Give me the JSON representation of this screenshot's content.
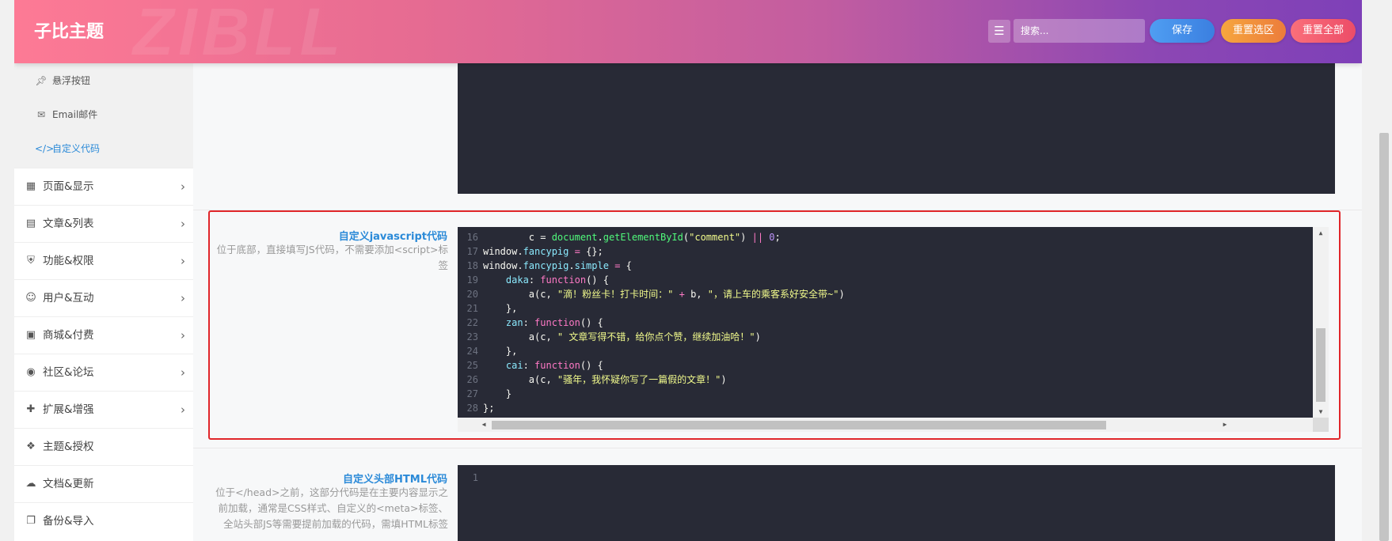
{
  "header": {
    "title": "子比主题",
    "watermark": "ZIBLL",
    "search_placeholder": "搜索...",
    "save_label": "保存",
    "reset_section_label": "重置选区",
    "reset_all_label": "重置全部"
  },
  "sidebar": {
    "sub_items": [
      {
        "icon": "pin-icon",
        "label": "悬浮按钮"
      },
      {
        "icon": "envelope-icon",
        "label": "Email邮件"
      },
      {
        "icon": "code-icon",
        "label": "自定义代码",
        "active": true
      }
    ],
    "items": [
      {
        "icon": "calendar-icon",
        "label": "页面&显示"
      },
      {
        "icon": "map-icon",
        "label": "文章&列表"
      },
      {
        "icon": "shield-icon",
        "label": "功能&权限"
      },
      {
        "icon": "user-icon",
        "label": "用户&互动"
      },
      {
        "icon": "cart-icon",
        "label": "商城&付费"
      },
      {
        "icon": "dribbble-icon",
        "label": "社区&论坛"
      },
      {
        "icon": "puzzle-icon",
        "label": "扩展&增强"
      },
      {
        "icon": "theme-icon",
        "label": "主题&授权"
      },
      {
        "icon": "cloud-download-icon",
        "label": "文档&更新"
      },
      {
        "icon": "copy-icon",
        "label": "备份&导入"
      }
    ]
  },
  "fields": {
    "js": {
      "title": "自定义javascript代码",
      "desc": "位于底部，直接填写JS代码，不需要添加<script>标签",
      "lines": [
        {
          "n": "16",
          "tokens": [
            [
              "",
              "        c = "
            ],
            [
              "fn",
              "document"
            ],
            [
              "",
              "."
            ],
            [
              "fn",
              "getElementById"
            ],
            [
              "",
              "("
            ],
            [
              "str",
              "\"comment\""
            ],
            [
              "",
              ") "
            ],
            [
              "kw",
              "||"
            ],
            [
              "",
              " "
            ],
            [
              "num",
              "0"
            ],
            [
              "",
              ";"
            ]
          ]
        },
        {
          "n": "17",
          "tokens": [
            [
              "",
              "window."
            ],
            [
              "prop",
              "fancypig"
            ],
            [
              "",
              " "
            ],
            [
              "kw",
              "="
            ],
            [
              "",
              " {};"
            ]
          ]
        },
        {
          "n": "18",
          "tokens": [
            [
              "",
              "window."
            ],
            [
              "prop",
              "fancypig"
            ],
            [
              "",
              "."
            ],
            [
              "prop",
              "simple"
            ],
            [
              "",
              " "
            ],
            [
              "kw",
              "="
            ],
            [
              "",
              " {"
            ]
          ]
        },
        {
          "n": "19",
          "tokens": [
            [
              "",
              "    "
            ],
            [
              "prop",
              "daka"
            ],
            [
              "",
              ": "
            ],
            [
              "kw",
              "function"
            ],
            [
              "",
              "() {"
            ]
          ]
        },
        {
          "n": "20",
          "tokens": [
            [
              "",
              "        a(c, "
            ],
            [
              "str",
              "\"滴！粉丝卡！打卡时间：\""
            ],
            [
              "",
              " "
            ],
            [
              "kw",
              "+"
            ],
            [
              "",
              " b, "
            ],
            [
              "str",
              "\"，请上车的乘客系好安全带~\""
            ],
            [
              "",
              ")"
            ]
          ]
        },
        {
          "n": "21",
          "tokens": [
            [
              "",
              "    },"
            ]
          ]
        },
        {
          "n": "22",
          "tokens": [
            [
              "",
              "    "
            ],
            [
              "prop",
              "zan"
            ],
            [
              "",
              ": "
            ],
            [
              "kw",
              "function"
            ],
            [
              "",
              "() {"
            ]
          ]
        },
        {
          "n": "23",
          "tokens": [
            [
              "",
              "        a(c, "
            ],
            [
              "str",
              "\" 文章写得不错，给你点个赞，继续加油哈！\""
            ],
            [
              "",
              ")"
            ]
          ]
        },
        {
          "n": "24",
          "tokens": [
            [
              "",
              "    },"
            ]
          ]
        },
        {
          "n": "25",
          "tokens": [
            [
              "",
              "    "
            ],
            [
              "prop",
              "cai"
            ],
            [
              "",
              ": "
            ],
            [
              "kw",
              "function"
            ],
            [
              "",
              "() {"
            ]
          ]
        },
        {
          "n": "26",
          "tokens": [
            [
              "",
              "        a(c, "
            ],
            [
              "str",
              "\"骚年，我怀疑你写了一篇假的文章！\""
            ],
            [
              "",
              ")"
            ]
          ]
        },
        {
          "n": "27",
          "tokens": [
            [
              "",
              "    }"
            ]
          ]
        },
        {
          "n": "28",
          "tokens": [
            [
              "",
              "};"
            ]
          ]
        }
      ]
    },
    "head_html": {
      "title": "自定义头部HTML代码",
      "desc": "位于</head>之前，这部分代码是在主要内容显示之前加载，通常是CSS样式、自定义的<meta>标签、全站头部JS等需要提前加载的代码，需填HTML标签",
      "first_line": "1"
    }
  }
}
